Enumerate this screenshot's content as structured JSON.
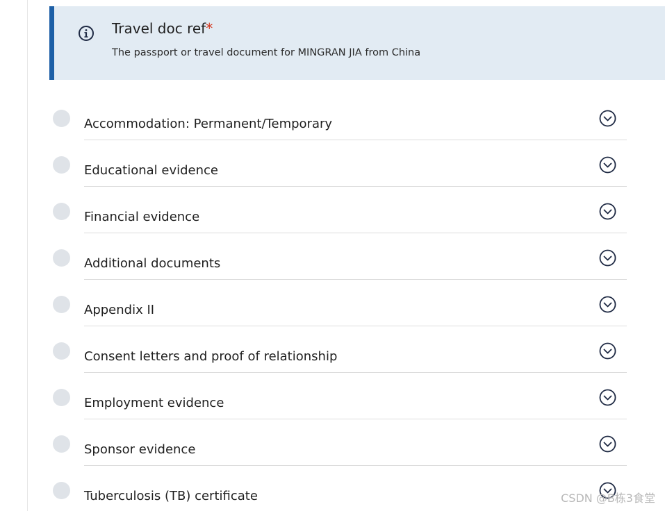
{
  "info_panel": {
    "title": "Travel doc ref",
    "required_marker": "*",
    "description": "The passport or travel document for MINGRAN JIA from China",
    "icon": "info-icon",
    "accent_color": "#1d5fa6",
    "background_color": "#e2ebf3"
  },
  "documents": [
    {
      "label": "Accommodation: Permanent/Temporary",
      "status_icon": "status-dot",
      "toggle_icon": "chevron-down-circle-icon"
    },
    {
      "label": "Educational evidence",
      "status_icon": "status-dot",
      "toggle_icon": "chevron-down-circle-icon"
    },
    {
      "label": "Financial evidence",
      "status_icon": "status-dot",
      "toggle_icon": "chevron-down-circle-icon"
    },
    {
      "label": "Additional documents",
      "status_icon": "status-dot",
      "toggle_icon": "chevron-down-circle-icon"
    },
    {
      "label": "Appendix II",
      "status_icon": "status-dot",
      "toggle_icon": "chevron-down-circle-icon"
    },
    {
      "label": "Consent letters and proof of relationship",
      "status_icon": "status-dot",
      "toggle_icon": "chevron-down-circle-icon"
    },
    {
      "label": "Employment evidence",
      "status_icon": "status-dot",
      "toggle_icon": "chevron-down-circle-icon"
    },
    {
      "label": "Sponsor evidence",
      "status_icon": "status-dot",
      "toggle_icon": "chevron-down-circle-icon"
    },
    {
      "label": "Tuberculosis (TB) certificate",
      "status_icon": "status-dot",
      "toggle_icon": "chevron-down-circle-icon"
    }
  ],
  "watermark": "CSDN @B栋3食堂"
}
